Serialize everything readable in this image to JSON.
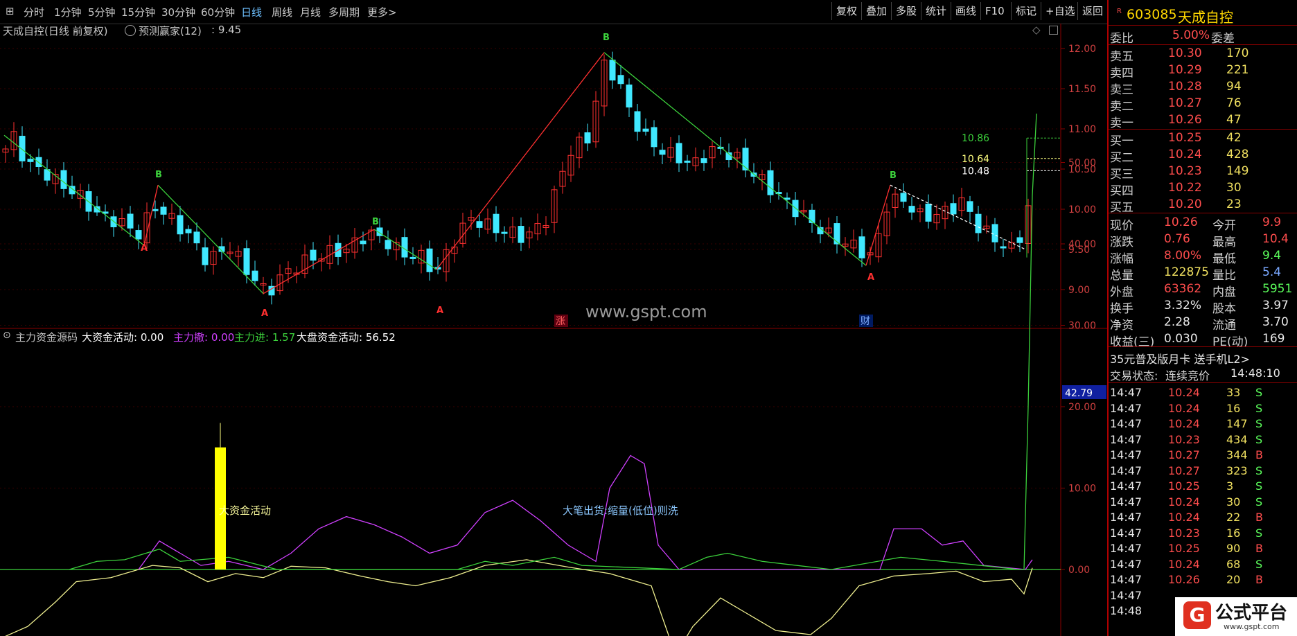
{
  "toolbar": {
    "periods": [
      "分时",
      "1分钟",
      "5分钟",
      "15分钟",
      "30分钟",
      "60分钟",
      "日线",
      "周线",
      "月线",
      "多周期",
      "更多>"
    ],
    "active_period": "日线",
    "buttons": [
      "复权",
      "叠加",
      "多股",
      "统计",
      "画线",
      "F10",
      "标记",
      "+自选",
      "返回"
    ]
  },
  "main_chart": {
    "title": "天成自控(日线 前复权)",
    "indicator_name": "预测赢家(12)",
    "indicator_value": ": 9.45",
    "price_ticks": [
      "12.00",
      "11.50",
      "11.00",
      "10.50",
      "10.00",
      "9.50",
      "9.00"
    ],
    "level_labels": [
      "10.86",
      "10.64",
      "10.48"
    ],
    "markers": {
      "a": "A",
      "b": "B",
      "zhang": "涨",
      "cai": "财"
    },
    "watermark": "www.gspt.com"
  },
  "sub_chart": {
    "name": "主力资金源码",
    "items": [
      {
        "label": "大资金活动:",
        "value": "0.00"
      },
      {
        "label": "主力撤:",
        "value": "0.00"
      },
      {
        "label": "主力进:",
        "value": "1.57"
      },
      {
        "label": "大盘资金活动:",
        "value": "56.52"
      }
    ],
    "ticks": [
      "50.00",
      "40.00",
      "30.00",
      "20.00",
      "10.00",
      "0.00"
    ],
    "current_value_label": "42.79",
    "annotation_big_money": "大资金活动",
    "annotation_shipping": "大笔出货:缩量(低位)则洗"
  },
  "chart_data": {
    "type": "candlestick",
    "title": "天成自控(日线 前复权)",
    "price_axis": [
      9.0,
      12.0
    ],
    "levels": [
      10.86,
      10.64,
      10.48
    ],
    "current_price": 10.26,
    "indicator_axis": [
      0,
      50
    ],
    "indicator_readouts": {
      "大资金活动": 0.0,
      "主力撤": 0.0,
      "主力进": 1.57,
      "大盘资金活动": 56.52
    },
    "indicator_current": 42.79
  },
  "quote": {
    "code": "603085",
    "name": "天成自控",
    "ratio_label": "委比",
    "ratio_value": "5.00%",
    "diff_label": "委差",
    "asks": [
      {
        "label": "卖五",
        "price": "10.30",
        "vol": "170"
      },
      {
        "label": "卖四",
        "price": "10.29",
        "vol": "221"
      },
      {
        "label": "卖三",
        "price": "10.28",
        "vol": "94"
      },
      {
        "label": "卖二",
        "price": "10.27",
        "vol": "76"
      },
      {
        "label": "卖一",
        "price": "10.26",
        "vol": "47"
      }
    ],
    "bids": [
      {
        "label": "买一",
        "price": "10.25",
        "vol": "42"
      },
      {
        "label": "买二",
        "price": "10.24",
        "vol": "428"
      },
      {
        "label": "买三",
        "price": "10.23",
        "vol": "149"
      },
      {
        "label": "买四",
        "price": "10.22",
        "vol": "30"
      },
      {
        "label": "买五",
        "price": "10.20",
        "vol": "23"
      }
    ],
    "stats": [
      {
        "l1": "现价",
        "v1": "10.26",
        "l2": "今开",
        "v2": "9.9"
      },
      {
        "l1": "涨跌",
        "v1": "0.76",
        "l2": "最高",
        "v2": "10.4"
      },
      {
        "l1": "涨幅",
        "v1": "8.00%",
        "l2": "最低",
        "v2": "9.4"
      },
      {
        "l1": "总量",
        "v1": "122875",
        "l2": "量比",
        "v2": "5.4"
      },
      {
        "l1": "外盘",
        "v1": "63362",
        "l2": "内盘",
        "v2": "5951"
      },
      {
        "l1": "换手",
        "v1": "3.32%",
        "l2": "股本",
        "v2": "3.97"
      },
      {
        "l1": "净资",
        "v1": "2.28",
        "l2": "流通",
        "v2": "3.70"
      },
      {
        "l1": "收益(三)",
        "v1": "0.030",
        "l2": "PE(动)",
        "v2": "169"
      }
    ],
    "promo": "35元普及版月卡 送手机L2>",
    "status_label": "交易状态:",
    "status_value": "连续竞价",
    "time": "14:48:10",
    "ticks": [
      {
        "t": "14:47",
        "p": "10.24",
        "v": "33",
        "s": "S"
      },
      {
        "t": "14:47",
        "p": "10.24",
        "v": "16",
        "s": "S"
      },
      {
        "t": "14:47",
        "p": "10.24",
        "v": "147",
        "s": "S"
      },
      {
        "t": "14:47",
        "p": "10.23",
        "v": "434",
        "s": "S"
      },
      {
        "t": "14:47",
        "p": "10.27",
        "v": "344",
        "s": "B"
      },
      {
        "t": "14:47",
        "p": "10.27",
        "v": "323",
        "s": "S"
      },
      {
        "t": "14:47",
        "p": "10.25",
        "v": "3",
        "s": "S"
      },
      {
        "t": "14:47",
        "p": "10.24",
        "v": "30",
        "s": "S"
      },
      {
        "t": "14:47",
        "p": "10.24",
        "v": "22",
        "s": "B"
      },
      {
        "t": "14:47",
        "p": "10.23",
        "v": "16",
        "s": "S"
      },
      {
        "t": "14:47",
        "p": "10.25",
        "v": "90",
        "s": "B"
      },
      {
        "t": "14:47",
        "p": "10.24",
        "v": "68",
        "s": "S"
      },
      {
        "t": "14:47",
        "p": "10.26",
        "v": "20",
        "s": "B"
      },
      {
        "t": "14:47",
        "p": "",
        "v": "",
        "s": ""
      },
      {
        "t": "14:48",
        "p": "",
        "v": "",
        "s": ""
      }
    ]
  },
  "brand": {
    "name": "公式平台",
    "url": "www.gspt.com"
  },
  "colors": {
    "up": "#ff3030",
    "down": "#40e8ff",
    "ma_green": "#3cd23c",
    "accent": "#ffff00"
  }
}
